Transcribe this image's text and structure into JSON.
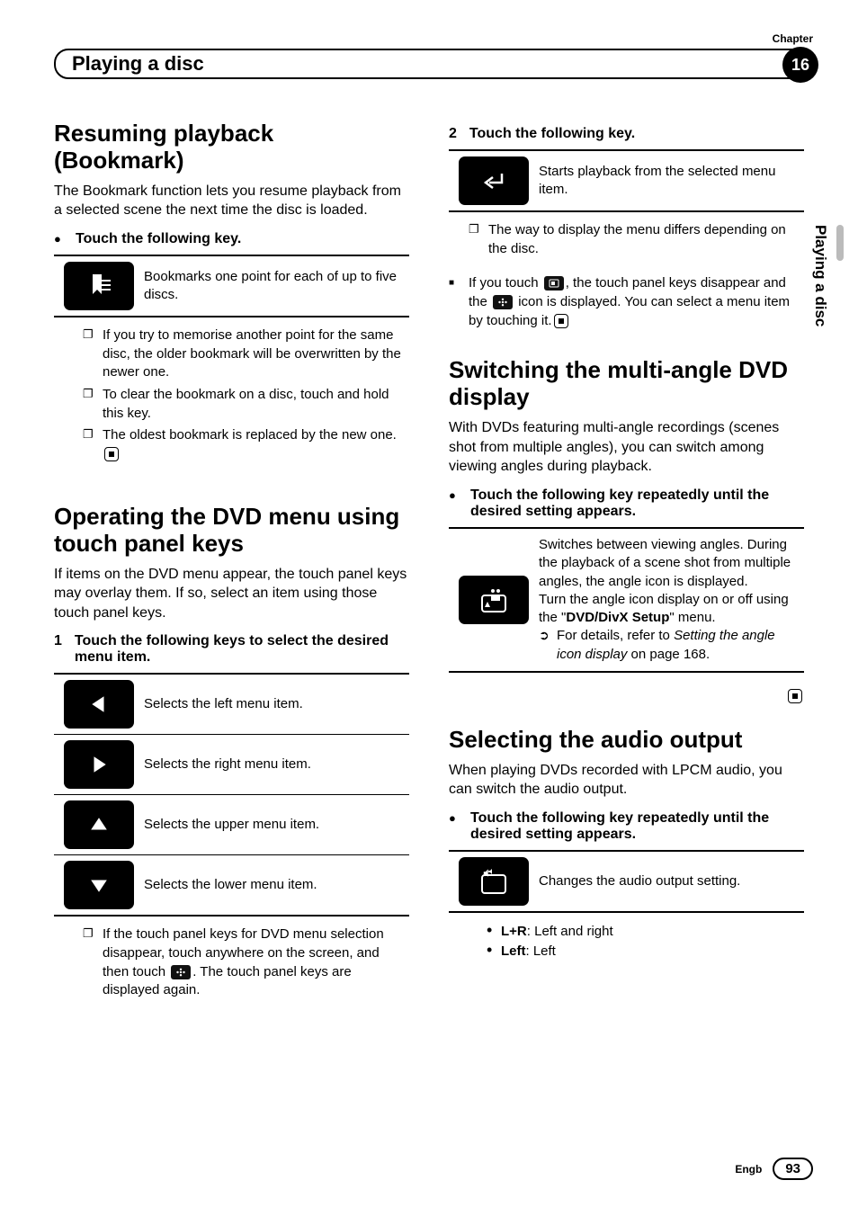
{
  "header": {
    "chapter_label": "Chapter",
    "title": "Playing a disc",
    "chapter_num": "16"
  },
  "sidetab": {
    "text": "Playing a disc"
  },
  "left": {
    "bookmark": {
      "heading": "Resuming playback (Bookmark)",
      "intro": "The Bookmark function lets you resume playback from a selected scene the next time the disc is loaded.",
      "step": "Touch the following key.",
      "key_desc": "Bookmarks one point for each of up to five discs.",
      "notes": {
        "n1": "If you try to memorise another point for the same disc, the older bookmark will be overwritten by the newer one.",
        "n2": "To clear the bookmark on a disc, touch and hold this key.",
        "n3_a": "The oldest bookmark is replaced by the new one."
      }
    },
    "dvdmenu": {
      "heading": "Operating the DVD menu using touch panel keys",
      "intro": "If items on the DVD menu appear, the touch panel keys may overlay them. If so, select an item using those touch panel keys.",
      "step1_num": "1",
      "step1": "Touch the following keys to select the desired menu item.",
      "rows": {
        "left": "Selects the left menu item.",
        "right": "Selects the right menu item.",
        "up": "Selects the upper menu item.",
        "down": "Selects the lower menu item."
      },
      "note_a": "If the touch panel keys for DVD menu selection disappear, touch anywhere on the screen, and then touch ",
      "note_b": ". The touch panel keys are displayed again."
    }
  },
  "right": {
    "step2_num": "2",
    "step2": "Touch the following key.",
    "step2_desc": "Starts playback from the selected menu item.",
    "note1": "The way to display the menu differs depending on the disc.",
    "note2_a": "If you touch ",
    "note2_b": ", the touch panel keys disappear and the ",
    "note2_c": " icon is displayed. You can select a menu item by touching it.",
    "multi": {
      "heading": "Switching the multi-angle DVD display",
      "intro": "With DVDs featuring multi-angle recordings (scenes shot from multiple angles), you can switch among viewing angles during playback.",
      "step": "Touch the following key repeatedly until the desired setting appears.",
      "desc_a": "Switches between viewing angles. During the playback of a scene shot from multiple angles, the angle icon is displayed.",
      "desc_b_pre": "Turn the angle icon display on or off using the \"",
      "desc_b_bold": "DVD/DivX Setup",
      "desc_b_post": "\" menu.",
      "ref_pre": "For details, refer to ",
      "ref_it": "Setting the angle icon display",
      "ref_post": " on page 168."
    },
    "audio": {
      "heading": "Selecting the audio output",
      "intro": "When playing DVDs recorded with LPCM audio, you can switch the audio output.",
      "step": "Touch the following key repeatedly until the desired setting appears.",
      "desc": "Changes the audio output setting.",
      "opts": {
        "lr_b": "L+R",
        "lr_t": ": Left and right",
        "left_b": "Left",
        "left_t": ": Left"
      }
    }
  },
  "footer": {
    "lang": "Engb",
    "page": "93"
  }
}
